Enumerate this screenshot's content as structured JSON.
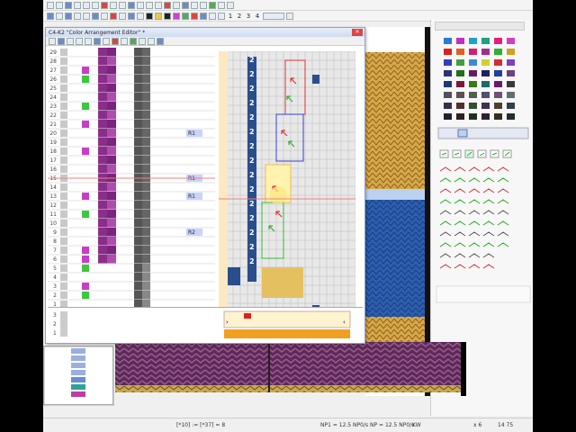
{
  "editor": {
    "title": "C4-K2 \"Color Arrangement Editor\" *"
  },
  "toolbar2": {
    "n1": "1",
    "n2": "2",
    "n3": "3",
    "n4": "4"
  },
  "rows_left": [
    "29",
    "28",
    "27",
    "26",
    "25",
    "24",
    "23",
    "22",
    "21",
    "20",
    "19",
    "18",
    "17",
    "16",
    "15",
    "14",
    "13",
    "12",
    "11",
    "10",
    "9",
    "8",
    "7",
    "6",
    "5",
    "4",
    "3",
    "2",
    "1"
  ],
  "bottom_rows": [
    "3",
    "2",
    "1"
  ],
  "tags": {
    "r1": "R1",
    "r2": "R2"
  },
  "status": {
    "coords": "[*10] := [*37] = 8",
    "mid": "NP1 = 12.5 NP0/s   NP = 12.5 NP0/s",
    "kw": "KW",
    "right1": "x 6",
    "right2": "14  75"
  },
  "colors": {
    "purple": "#8a2e8a",
    "magenta": "#c83cc8",
    "green": "#3cc83c",
    "blue": "#2a4e8c",
    "gold": "#d4a040",
    "red": "#e02020"
  }
}
